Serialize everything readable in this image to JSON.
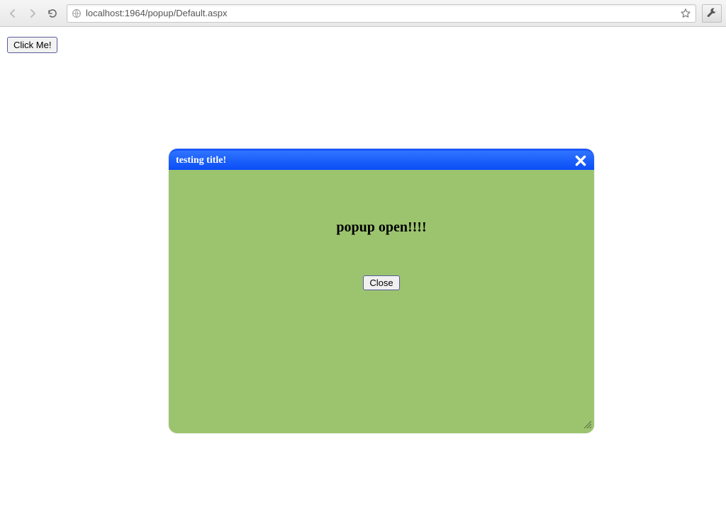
{
  "browser": {
    "url": "localhost:1964/popup/Default.aspx"
  },
  "page": {
    "click_me_label": "Click Me!"
  },
  "popup": {
    "title": "testing title!",
    "message": "popup open!!!!",
    "close_label": "Close"
  }
}
